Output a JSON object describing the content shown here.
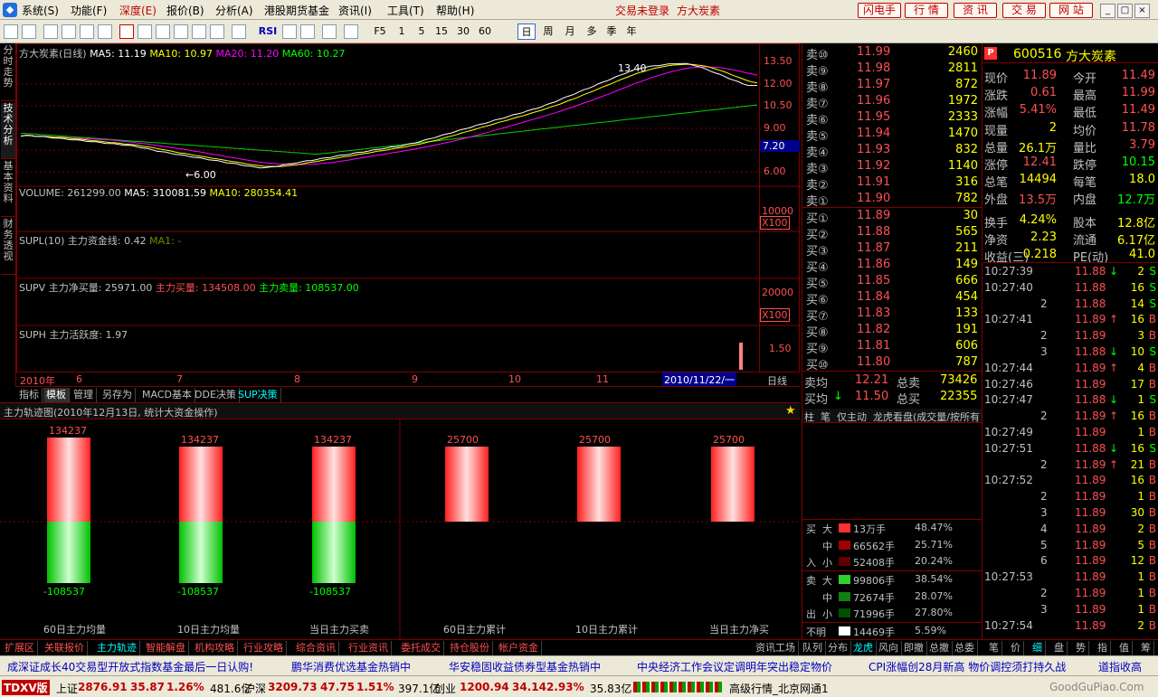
{
  "app": {
    "menus": [
      "系统(S)",
      "功能(F)",
      "深度(E)",
      "报价(B)",
      "分析(A)",
      "港股期货基金",
      "资讯(I)",
      "工具(T)",
      "帮助(H)"
    ],
    "login_status": "交易未登录",
    "stock_name_top": "方大炭素",
    "right_buttons": [
      "闪电手",
      "行 情",
      "资 讯",
      "交 易",
      "网 站"
    ]
  },
  "toolbar": {
    "periods": [
      "F5",
      "1",
      "5",
      "15",
      "30",
      "60",
      "日",
      "周",
      "月",
      "多",
      "季",
      "年"
    ],
    "rsi": "RSI",
    "active_period": "日"
  },
  "left_tabs": [
    "分时走势",
    "技术分析",
    "基本资料",
    "财务透视"
  ],
  "chart": {
    "title": "方大炭素(日线)",
    "ma5": "MA5: 11.19",
    "ma10": "MA10: 10.97",
    "ma20": "MA20: 11.20",
    "ma60": "MA60: 10.27",
    "price_ticks": [
      "13.50",
      "12.00",
      "10.50",
      "9.00",
      "7.20",
      "6.00"
    ],
    "high_label": "13.40",
    "low_label": "←6.00",
    "volume_title": "VOLUME: 261299.00",
    "vol_ma5": "MA5: 310081.59",
    "vol_ma10": "MA10: 280354.41",
    "vol_ticks": [
      "10000",
      "X100"
    ],
    "supl_title": "SUPL(10) 主力资金线: 0.42",
    "supl_ma": "MA1: -",
    "supv_title": "SUPV 主力净买量: 25971.00",
    "supv_buy": "主力买量: 134508.00",
    "supv_sell": "主力卖量: 108537.00",
    "supv_ticks": [
      "20000",
      "X100"
    ],
    "suph_title": "SUPH 主力活跃度: 1.97",
    "suph_tick": "1.50",
    "dates": [
      "2010年",
      "6",
      "7",
      "8",
      "9",
      "10",
      "11",
      "2010/11/22/一"
    ],
    "period_label": "日线"
  },
  "bottom_tabs": [
    "指标",
    "模板",
    "管理",
    "另存为",
    "MACD基本",
    "DDE决策",
    "SUP决策"
  ],
  "track": {
    "title": "主力轨迹图(2010年12月13日, 统计大资金操作)",
    "groups": [
      {
        "label": "60日主力均量",
        "top": "134237",
        "bottom": "-108537"
      },
      {
        "label": "10日主力均量",
        "top": "134237",
        "bottom": "-108537"
      },
      {
        "label": "当日主力买卖",
        "top": "134237",
        "bottom": "-108537"
      },
      {
        "label": "60日主力累计",
        "top": "25700",
        "bottom": ""
      },
      {
        "label": "10日主力累计",
        "top": "25700",
        "bottom": ""
      },
      {
        "label": "当日主力净买",
        "top": "25700",
        "bottom": ""
      }
    ]
  },
  "orderbook": {
    "sell": [
      {
        "n": "卖⑩",
        "p": "11.99",
        "v": "2460"
      },
      {
        "n": "卖⑨",
        "p": "11.98",
        "v": "2811"
      },
      {
        "n": "卖⑧",
        "p": "11.97",
        "v": "872"
      },
      {
        "n": "卖⑦",
        "p": "11.96",
        "v": "1972"
      },
      {
        "n": "卖⑥",
        "p": "11.95",
        "v": "2333"
      },
      {
        "n": "卖⑤",
        "p": "11.94",
        "v": "1470"
      },
      {
        "n": "卖④",
        "p": "11.93",
        "v": "832"
      },
      {
        "n": "卖③",
        "p": "11.92",
        "v": "1140"
      },
      {
        "n": "卖②",
        "p": "11.91",
        "v": "316"
      },
      {
        "n": "卖①",
        "p": "11.90",
        "v": "782"
      }
    ],
    "buy": [
      {
        "n": "买①",
        "p": "11.89",
        "v": "30"
      },
      {
        "n": "买②",
        "p": "11.88",
        "v": "565"
      },
      {
        "n": "买③",
        "p": "11.87",
        "v": "211"
      },
      {
        "n": "买④",
        "p": "11.86",
        "v": "149"
      },
      {
        "n": "买⑤",
        "p": "11.85",
        "v": "666"
      },
      {
        "n": "买⑥",
        "p": "11.84",
        "v": "454"
      },
      {
        "n": "买⑦",
        "p": "11.83",
        "v": "133"
      },
      {
        "n": "买⑧",
        "p": "11.82",
        "v": "191"
      },
      {
        "n": "买⑨",
        "p": "11.81",
        "v": "606"
      },
      {
        "n": "买⑩",
        "p": "11.80",
        "v": "787"
      }
    ],
    "sell_avg_label": "卖均",
    "sell_avg": "12.21",
    "total_sell_label": "总卖",
    "total_sell": "73426",
    "buy_avg_label": "买均",
    "buy_avg": "11.50",
    "total_buy_label": "总买",
    "total_buy": "22355"
  },
  "dist_tabs": [
    "柱",
    "笔",
    "仅主动",
    "龙虎看盘(成交量/按所有"
  ],
  "dist": {
    "buy_rows": [
      {
        "size": "大",
        "vol": "13万手",
        "pct": "48.47%",
        "color": "#ff3030"
      },
      {
        "size": "中",
        "vol": "66562手",
        "pct": "25.71%",
        "color": "#a00000"
      },
      {
        "size": "小",
        "vol": "52408手",
        "pct": "20.24%",
        "color": "#600000"
      }
    ],
    "sell_rows": [
      {
        "size": "大",
        "vol": "99806手",
        "pct": "38.54%",
        "color": "#30d030"
      },
      {
        "size": "中",
        "vol": "72674手",
        "pct": "28.07%",
        "color": "#108010"
      },
      {
        "size": "小",
        "vol": "71996手",
        "pct": "27.80%",
        "color": "#005000"
      }
    ],
    "unknown_label": "不明",
    "unknown_vol": "14469手",
    "unknown_pct": "5.59%",
    "buy_side": [
      "买",
      "入"
    ],
    "sell_side": [
      "卖",
      "出"
    ]
  },
  "quote": {
    "code": "600516",
    "name": "方大炭素",
    "rows": [
      [
        "现价",
        "11.89",
        "今开",
        "11.49"
      ],
      [
        "涨跌",
        "0.61",
        "最高",
        "11.99"
      ],
      [
        "涨幅",
        "5.41%",
        "最低",
        "11.49"
      ],
      [
        "现量",
        "2",
        "均价",
        "11.78"
      ],
      [
        "总量",
        "26.1万",
        "量比",
        "3.79"
      ],
      [
        "涨停",
        "12.41",
        "跌停",
        "10.15"
      ],
      [
        "总笔",
        "14494",
        "每笔",
        "18.0"
      ],
      [
        "外盘",
        "13.5万",
        "内盘",
        "12.7万"
      ],
      [
        "换手",
        "4.24%",
        "股本",
        "12.8亿"
      ],
      [
        "净资",
        "2.23",
        "流通",
        "6.17亿"
      ],
      [
        "收益(三)",
        "0.218",
        "PE(动)",
        "41.0"
      ]
    ]
  },
  "trades": [
    {
      "t": "10:27:39",
      "p": "11.88",
      "a": "↓",
      "v": "2",
      "s": "S"
    },
    {
      "t": "10:27:40",
      "p": "11.88",
      "a": "",
      "v": "16",
      "s": "S"
    },
    {
      "t": "2",
      "p": "11.88",
      "a": "",
      "v": "14",
      "s": "S"
    },
    {
      "t": "10:27:41",
      "p": "11.89",
      "a": "↑",
      "v": "16",
      "s": "B"
    },
    {
      "t": "2",
      "p": "11.89",
      "a": "",
      "v": "3",
      "s": "B"
    },
    {
      "t": "3",
      "p": "11.88",
      "a": "↓",
      "v": "10",
      "s": "S"
    },
    {
      "t": "10:27:44",
      "p": "11.89",
      "a": "↑",
      "v": "4",
      "s": "B"
    },
    {
      "t": "10:27:46",
      "p": "11.89",
      "a": "",
      "v": "17",
      "s": "B"
    },
    {
      "t": "10:27:47",
      "p": "11.88",
      "a": "↓",
      "v": "1",
      "s": "S"
    },
    {
      "t": "2",
      "p": "11.89",
      "a": "↑",
      "v": "16",
      "s": "B"
    },
    {
      "t": "10:27:49",
      "p": "11.89",
      "a": "",
      "v": "1",
      "s": "B"
    },
    {
      "t": "10:27:51",
      "p": "11.88",
      "a": "↓",
      "v": "16",
      "s": "S"
    },
    {
      "t": "2",
      "p": "11.89",
      "a": "↑",
      "v": "21",
      "s": "B"
    },
    {
      "t": "10:27:52",
      "p": "11.89",
      "a": "",
      "v": "16",
      "s": "B"
    },
    {
      "t": "2",
      "p": "11.89",
      "a": "",
      "v": "1",
      "s": "B"
    },
    {
      "t": "3",
      "p": "11.89",
      "a": "",
      "v": "30",
      "s": "B"
    },
    {
      "t": "4",
      "p": "11.89",
      "a": "",
      "v": "2",
      "s": "B"
    },
    {
      "t": "5",
      "p": "11.89",
      "a": "",
      "v": "5",
      "s": "B"
    },
    {
      "t": "6",
      "p": "11.89",
      "a": "",
      "v": "12",
      "s": "B"
    },
    {
      "t": "10:27:53",
      "p": "11.89",
      "a": "",
      "v": "1",
      "s": "B"
    },
    {
      "t": "2",
      "p": "11.89",
      "a": "",
      "v": "1",
      "s": "B"
    },
    {
      "t": "3",
      "p": "11.89",
      "a": "",
      "v": "1",
      "s": "B"
    },
    {
      "t": "10:27:54",
      "p": "11.89",
      "a": "",
      "v": "2",
      "s": "B"
    }
  ],
  "status_tabs": [
    "扩展区",
    "关联报价",
    "主力轨迹",
    "智能解盘",
    "机构攻略",
    "行业攻略",
    "综合资讯",
    "行业资讯",
    "委托成交",
    "持仓股份",
    "帐户资金"
  ],
  "status_right": [
    "资讯工场",
    "队列",
    "分布",
    "龙虎",
    "风向",
    "即撤",
    "总撤",
    "总委"
  ],
  "trade_tabs": [
    "笔",
    "价",
    "细",
    "盘",
    "势",
    "指",
    "值",
    "筹"
  ],
  "ticker": [
    "成深证成长40交易型开放式指数基金最后一日认购!",
    "鹏华消费优选基金热销中",
    "华安稳固收益债券型基金热销中",
    "中央经济工作会议定调明年突出稳定物价",
    "CPI涨幅创28月新高 物价调控须打持久战",
    "道指收高"
  ],
  "indexbar": {
    "sh_label": "上证",
    "sh_val": "2876.91",
    "sh_chg": "35.87",
    "sh_pct": "1.26%",
    "sh_amt": "481.6亿",
    "hs_label": "沪深",
    "hs_val": "3209.73",
    "hs_chg": "47.75",
    "hs_pct": "1.51%",
    "hs_amt": "397.1亿",
    "cy_label": "创业",
    "cy_val": "1200.94",
    "cy_chg": "34.14",
    "cy_pct": "2.93%",
    "cy_amt": "35.83亿",
    "conn": "高级行情_北京网通1",
    "brand": "TDXV版",
    "watermark": "GoodGuPiao.Com"
  }
}
